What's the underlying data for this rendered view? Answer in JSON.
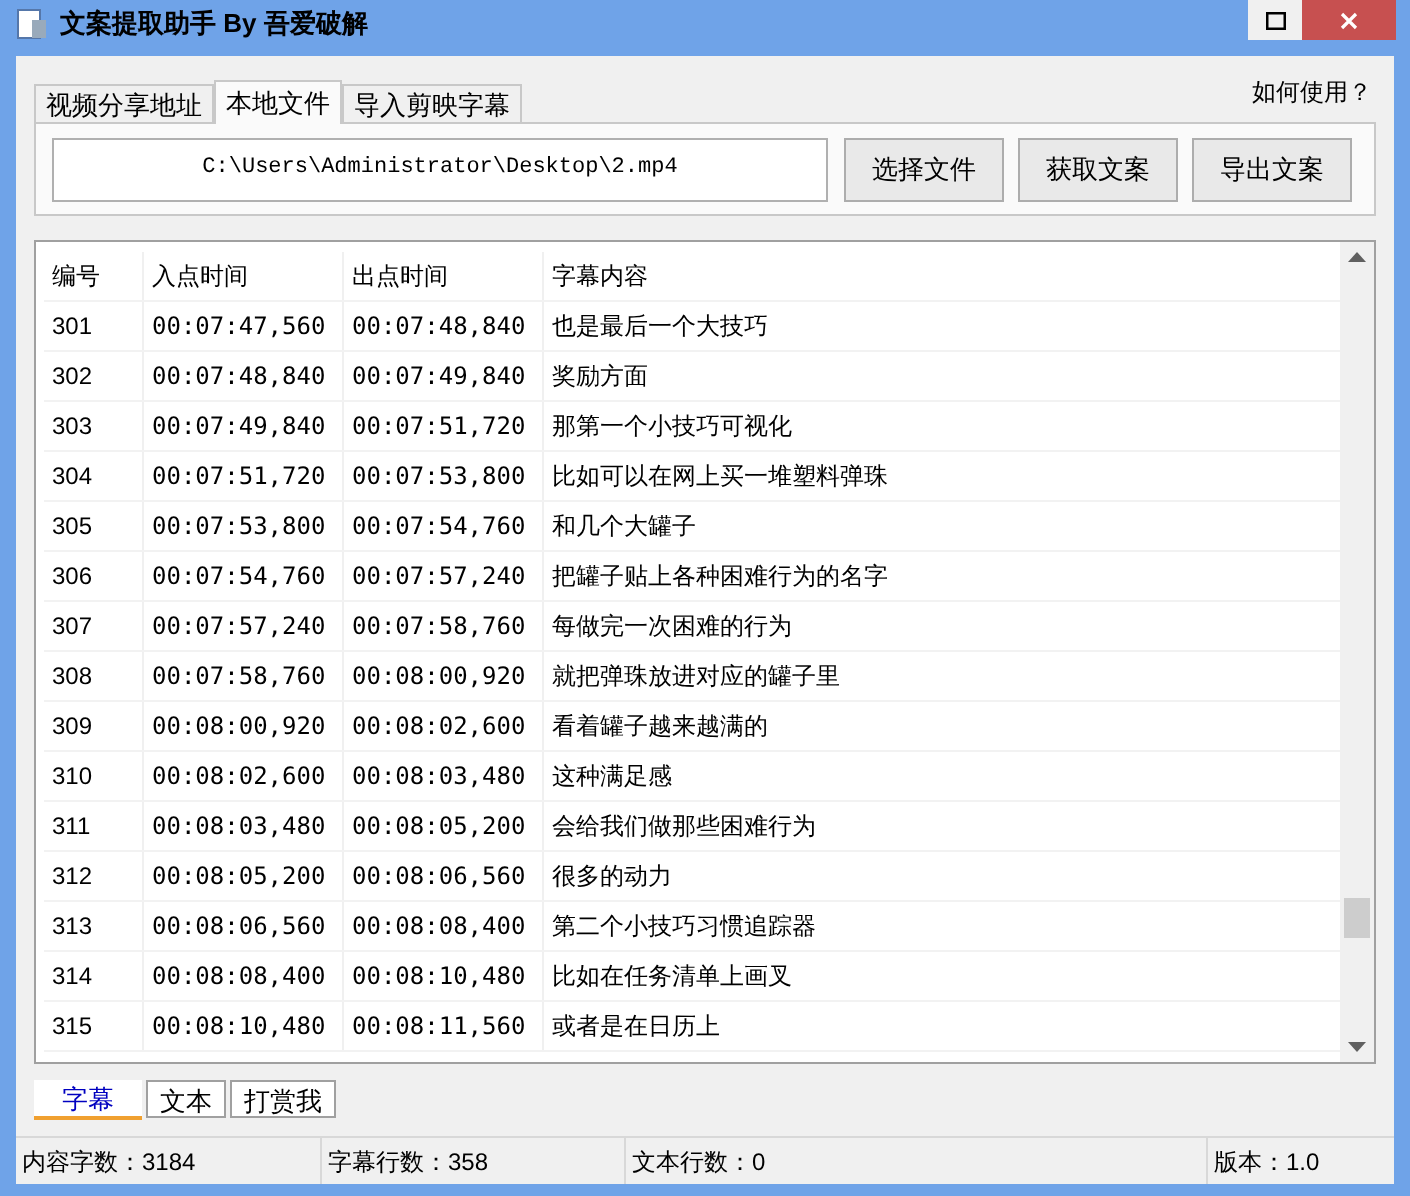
{
  "window": {
    "title": "文案提取助手 By 吾爱破解"
  },
  "tabs": [
    {
      "label": "视频分享地址",
      "selected": false
    },
    {
      "label": "本地文件",
      "selected": true
    },
    {
      "label": "导入剪映字幕",
      "selected": false
    }
  ],
  "help_link": "如何使用？",
  "file_path": "C:\\Users\\Administrator\\Desktop\\2.mp4",
  "buttons": [
    "选择文件",
    "获取文案",
    "导出文案"
  ],
  "table": {
    "columns": [
      "编号",
      "入点时间",
      "出点时间",
      "字幕内容"
    ],
    "rows": [
      [
        "301",
        "00:07:47,560",
        "00:07:48,840",
        "也是最后一个大技巧"
      ],
      [
        "302",
        "00:07:48,840",
        "00:07:49,840",
        "奖励方面"
      ],
      [
        "303",
        "00:07:49,840",
        "00:07:51,720",
        "那第一个小技巧可视化"
      ],
      [
        "304",
        "00:07:51,720",
        "00:07:53,800",
        "比如可以在网上买一堆塑料弹珠"
      ],
      [
        "305",
        "00:07:53,800",
        "00:07:54,760",
        "和几个大罐子"
      ],
      [
        "306",
        "00:07:54,760",
        "00:07:57,240",
        "把罐子贴上各种困难行为的名字"
      ],
      [
        "307",
        "00:07:57,240",
        "00:07:58,760",
        "每做完一次困难的行为"
      ],
      [
        "308",
        "00:07:58,760",
        "00:08:00,920",
        "就把弹珠放进对应的罐子里"
      ],
      [
        "309",
        "00:08:00,920",
        "00:08:02,600",
        "看着罐子越来越满的"
      ],
      [
        "310",
        "00:08:02,600",
        "00:08:03,480",
        "这种满足感"
      ],
      [
        "311",
        "00:08:03,480",
        "00:08:05,200",
        "会给我们做那些困难行为"
      ],
      [
        "312",
        "00:08:05,200",
        "00:08:06,560",
        "很多的动力"
      ],
      [
        "313",
        "00:08:06,560",
        "00:08:08,400",
        "第二个小技巧习惯追踪器"
      ],
      [
        "314",
        "00:08:08,400",
        "00:08:10,480",
        "比如在任务清单上画叉"
      ],
      [
        "315",
        "00:08:10,480",
        "00:08:11,560",
        "或者是在日历上"
      ]
    ]
  },
  "bottom_tabs": [
    {
      "label": "字幕",
      "selected": true
    },
    {
      "label": "文本",
      "selected": false
    },
    {
      "label": "打赏我",
      "selected": false
    }
  ],
  "status_bar": [
    "内容字数：3184",
    "字幕行数：358",
    "文本行数：0",
    "版本：1.0"
  ]
}
